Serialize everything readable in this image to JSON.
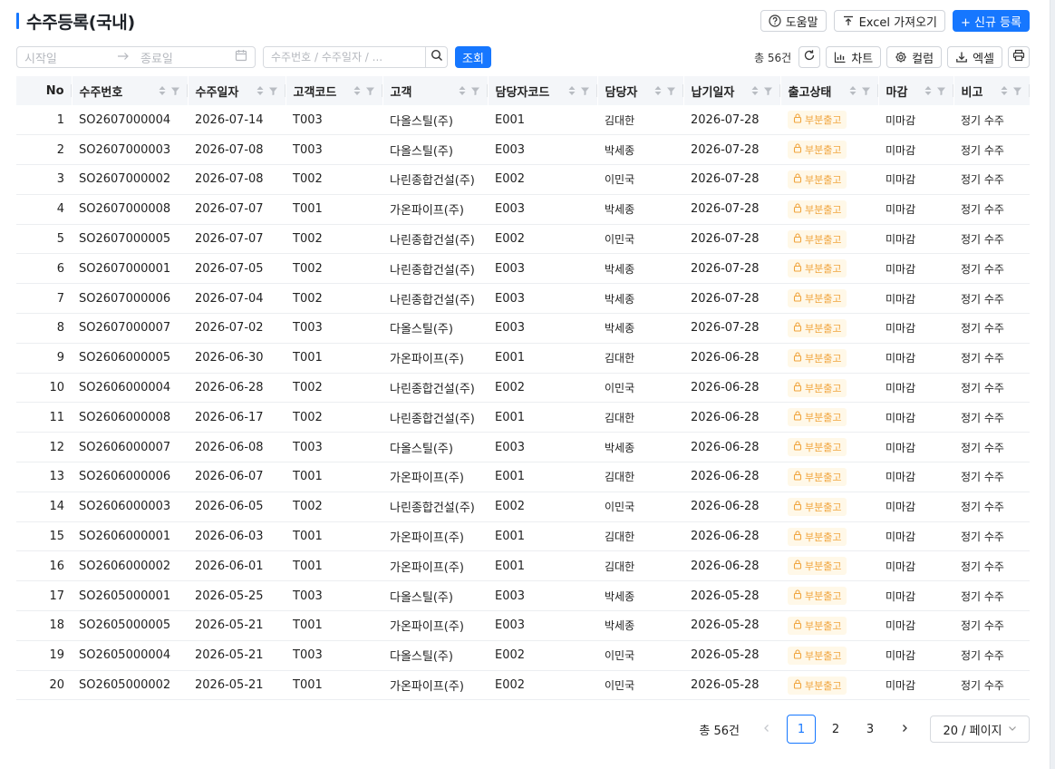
{
  "header": {
    "title": "수주등록(국내)",
    "help_label": "도움말",
    "excel_import_label": "Excel 가져오기",
    "new_label": "+ 신규 등록"
  },
  "filters": {
    "start_placeholder": "시작일",
    "end_placeholder": "종료일",
    "search_placeholder": "수주번호 / 수주일자 / ...",
    "query_label": "조회",
    "total_count": "총 56건",
    "chart_label": "차트",
    "column_label": "컬럼",
    "excel_label": "엑셀"
  },
  "table": {
    "columns": [
      "No",
      "수주번호",
      "수주일자",
      "고객코드",
      "고객",
      "담당자코드",
      "담당자",
      "납기일자",
      "출고상태",
      "마감",
      "비고"
    ],
    "rows": [
      [
        "1",
        "SO2607000004",
        "2026-07-14",
        "T003",
        "다올스틸(주)",
        "E001",
        "김대한",
        "2026-07-28",
        "부분출고",
        "미마감",
        "정기 수주"
      ],
      [
        "2",
        "SO2607000003",
        "2026-07-08",
        "T003",
        "다올스틸(주)",
        "E003",
        "박세종",
        "2026-07-28",
        "부분출고",
        "미마감",
        "정기 수주"
      ],
      [
        "3",
        "SO2607000002",
        "2026-07-08",
        "T002",
        "나린종합건설(주)",
        "E002",
        "이민국",
        "2026-07-28",
        "부분출고",
        "미마감",
        "정기 수주"
      ],
      [
        "4",
        "SO2607000008",
        "2026-07-07",
        "T001",
        "가온파이프(주)",
        "E003",
        "박세종",
        "2026-07-28",
        "부분출고",
        "미마감",
        "정기 수주"
      ],
      [
        "5",
        "SO2607000005",
        "2026-07-07",
        "T002",
        "나린종합건설(주)",
        "E002",
        "이민국",
        "2026-07-28",
        "부분출고",
        "미마감",
        "정기 수주"
      ],
      [
        "6",
        "SO2607000001",
        "2026-07-05",
        "T002",
        "나린종합건설(주)",
        "E003",
        "박세종",
        "2026-07-28",
        "부분출고",
        "미마감",
        "정기 수주"
      ],
      [
        "7",
        "SO2607000006",
        "2026-07-04",
        "T002",
        "나린종합건설(주)",
        "E003",
        "박세종",
        "2026-07-28",
        "부분출고",
        "미마감",
        "정기 수주"
      ],
      [
        "8",
        "SO2607000007",
        "2026-07-02",
        "T003",
        "다올스틸(주)",
        "E003",
        "박세종",
        "2026-07-28",
        "부분출고",
        "미마감",
        "정기 수주"
      ],
      [
        "9",
        "SO2606000005",
        "2026-06-30",
        "T001",
        "가온파이프(주)",
        "E001",
        "김대한",
        "2026-06-28",
        "부분출고",
        "미마감",
        "정기 수주"
      ],
      [
        "10",
        "SO2606000004",
        "2026-06-28",
        "T002",
        "나린종합건설(주)",
        "E002",
        "이민국",
        "2026-06-28",
        "부분출고",
        "미마감",
        "정기 수주"
      ],
      [
        "11",
        "SO2606000008",
        "2026-06-17",
        "T002",
        "나린종합건설(주)",
        "E001",
        "김대한",
        "2026-06-28",
        "부분출고",
        "미마감",
        "정기 수주"
      ],
      [
        "12",
        "SO2606000007",
        "2026-06-08",
        "T003",
        "다올스틸(주)",
        "E003",
        "박세종",
        "2026-06-28",
        "부분출고",
        "미마감",
        "정기 수주"
      ],
      [
        "13",
        "SO2606000006",
        "2026-06-07",
        "T001",
        "가온파이프(주)",
        "E001",
        "김대한",
        "2026-06-28",
        "부분출고",
        "미마감",
        "정기 수주"
      ],
      [
        "14",
        "SO2606000003",
        "2026-06-05",
        "T002",
        "나린종합건설(주)",
        "E002",
        "이민국",
        "2026-06-28",
        "부분출고",
        "미마감",
        "정기 수주"
      ],
      [
        "15",
        "SO2606000001",
        "2026-06-03",
        "T001",
        "가온파이프(주)",
        "E001",
        "김대한",
        "2026-06-28",
        "부분출고",
        "미마감",
        "정기 수주"
      ],
      [
        "16",
        "SO2606000002",
        "2026-06-01",
        "T001",
        "가온파이프(주)",
        "E001",
        "김대한",
        "2026-06-28",
        "부분출고",
        "미마감",
        "정기 수주"
      ],
      [
        "17",
        "SO2605000001",
        "2026-05-25",
        "T003",
        "다올스틸(주)",
        "E003",
        "박세종",
        "2026-05-28",
        "부분출고",
        "미마감",
        "정기 수주"
      ],
      [
        "18",
        "SO2605000005",
        "2026-05-21",
        "T001",
        "가온파이프(주)",
        "E003",
        "박세종",
        "2026-05-28",
        "부분출고",
        "미마감",
        "정기 수주"
      ],
      [
        "19",
        "SO2605000004",
        "2026-05-21",
        "T003",
        "다올스틸(주)",
        "E002",
        "이민국",
        "2026-05-28",
        "부분출고",
        "미마감",
        "정기 수주"
      ],
      [
        "20",
        "SO2605000002",
        "2026-05-21",
        "T001",
        "가온파이프(주)",
        "E002",
        "이민국",
        "2026-05-28",
        "부분출고",
        "미마감",
        "정기 수주"
      ]
    ]
  },
  "pagination": {
    "total": "총 56건",
    "pages": [
      "1",
      "2",
      "3"
    ],
    "current": "1",
    "page_size": "20 / 페이지"
  },
  "colors": {
    "accent": "#1677ff",
    "badge_bg": "#fff8e8",
    "badge_text": "#f0a43c"
  }
}
